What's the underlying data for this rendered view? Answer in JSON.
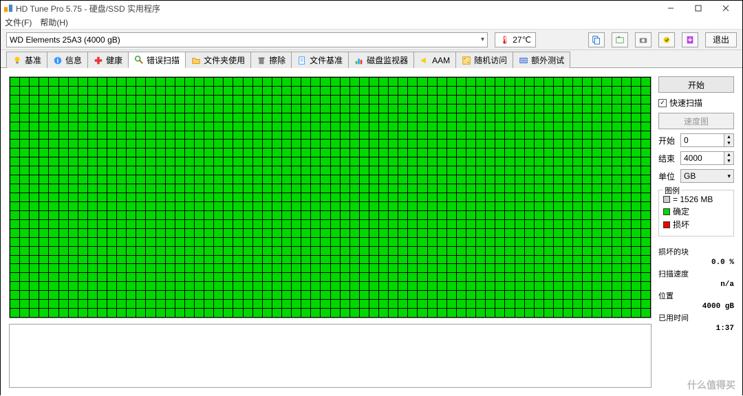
{
  "window": {
    "title": "HD Tune Pro 5.75 - 硬盘/SSD 实用程序",
    "minimize": "—",
    "maximize": "□",
    "close": "×"
  },
  "menu": {
    "file": "文件(F)",
    "help": "帮助(H)"
  },
  "toolbar": {
    "drive_text": "WD      Elements 25A3 (4000 gB)",
    "temperature": "27℃",
    "exit_label": "退出"
  },
  "tabs": [
    {
      "label": "基准",
      "icon": "bulb"
    },
    {
      "label": "信息",
      "icon": "info"
    },
    {
      "label": "健康",
      "icon": "plus"
    },
    {
      "label": "错误扫描",
      "icon": "search"
    },
    {
      "label": "文件夹使用",
      "icon": "folder"
    },
    {
      "label": "擦除",
      "icon": "trash"
    },
    {
      "label": "文件基准",
      "icon": "file"
    },
    {
      "label": "磁盘监视器",
      "icon": "chart"
    },
    {
      "label": "AAM",
      "icon": "speaker"
    },
    {
      "label": "随机访问",
      "icon": "random"
    },
    {
      "label": "额外测试",
      "icon": "extra"
    }
  ],
  "active_tab": 3,
  "panel": {
    "start_btn": "开始",
    "quick_scan": "快速扫描",
    "quick_scan_checked": true,
    "speed_map_btn": "速度图",
    "start_label": "开始",
    "start_value": "0",
    "end_label": "结束",
    "end_value": "4000",
    "unit_label": "单位",
    "unit_value": "GB",
    "legend": {
      "title": "图例",
      "block_size": "= 1526 MB",
      "ok": "确定",
      "damaged": "损坏"
    },
    "stats": {
      "damaged_blocks_label": "损坏的块",
      "damaged_blocks_value": "0.0 %",
      "scan_speed_label": "扫描速度",
      "scan_speed_value": "n/a",
      "position_label": "位置",
      "position_value": "4000 gB",
      "elapsed_label": "已用时间",
      "elapsed_value": "1:37"
    }
  },
  "watermark": "什么值得买",
  "grid": {
    "rows": 27,
    "cols": 66,
    "fill": "ok"
  }
}
